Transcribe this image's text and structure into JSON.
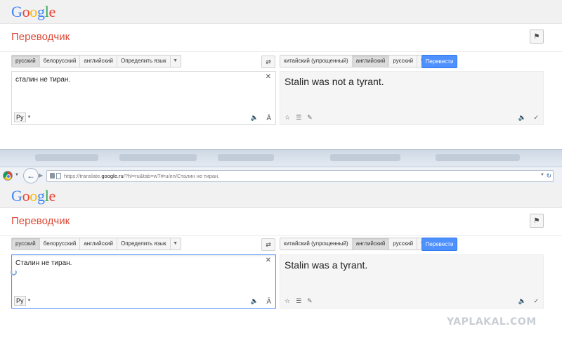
{
  "top": {
    "logo": [
      {
        "ch": "G",
        "color": "#4285f4"
      },
      {
        "ch": "o",
        "color": "#ea4335"
      },
      {
        "ch": "o",
        "color": "#fbbc05"
      },
      {
        "ch": "g",
        "color": "#4285f4"
      },
      {
        "ch": "l",
        "color": "#34a853"
      },
      {
        "ch": "e",
        "color": "#ea4335"
      }
    ],
    "title": "Переводчик",
    "source_langs": [
      "русский",
      "белорусский",
      "английский",
      "Определить язык"
    ],
    "source_selected": 0,
    "target_langs": [
      "китайский (упрощенный)",
      "английский",
      "русский"
    ],
    "target_selected": 1,
    "translate_label": "Перевести",
    "source_text": "сталин не тиран.",
    "ime_label": "Ру",
    "translation": "Stalin was not a tyrant."
  },
  "browser": {
    "url_prefix": "https://translate.",
    "url_domain": "google.ru",
    "url_suffix": "/?hl=ru&tab=wT#ru/en/Сталин не тиран."
  },
  "bottom": {
    "title": "Переводчик",
    "source_langs": [
      "русский",
      "белорусский",
      "английский",
      "Определить язык"
    ],
    "source_selected": 0,
    "target_langs": [
      "китайский (упрощенный)",
      "английский",
      "русский"
    ],
    "target_selected": 1,
    "translate_label": "Перевести",
    "source_text": "Сталин не тиран.",
    "ime_label": "Ру",
    "translation": "Stalin was a tyrant."
  },
  "icons": {
    "swap": "swap-languages-icon",
    "clear": "clear-icon",
    "speak": "speaker-icon",
    "keyboard": "keyboard-icon",
    "star": "star-icon",
    "list": "list-icon",
    "pencil": "pencil-icon",
    "check": "check-icon",
    "bookmark": "bookmark-icon"
  },
  "watermark": "YAPLAKAL.COM",
  "accent": "#4d90fe",
  "title_color": "#dd4b39"
}
